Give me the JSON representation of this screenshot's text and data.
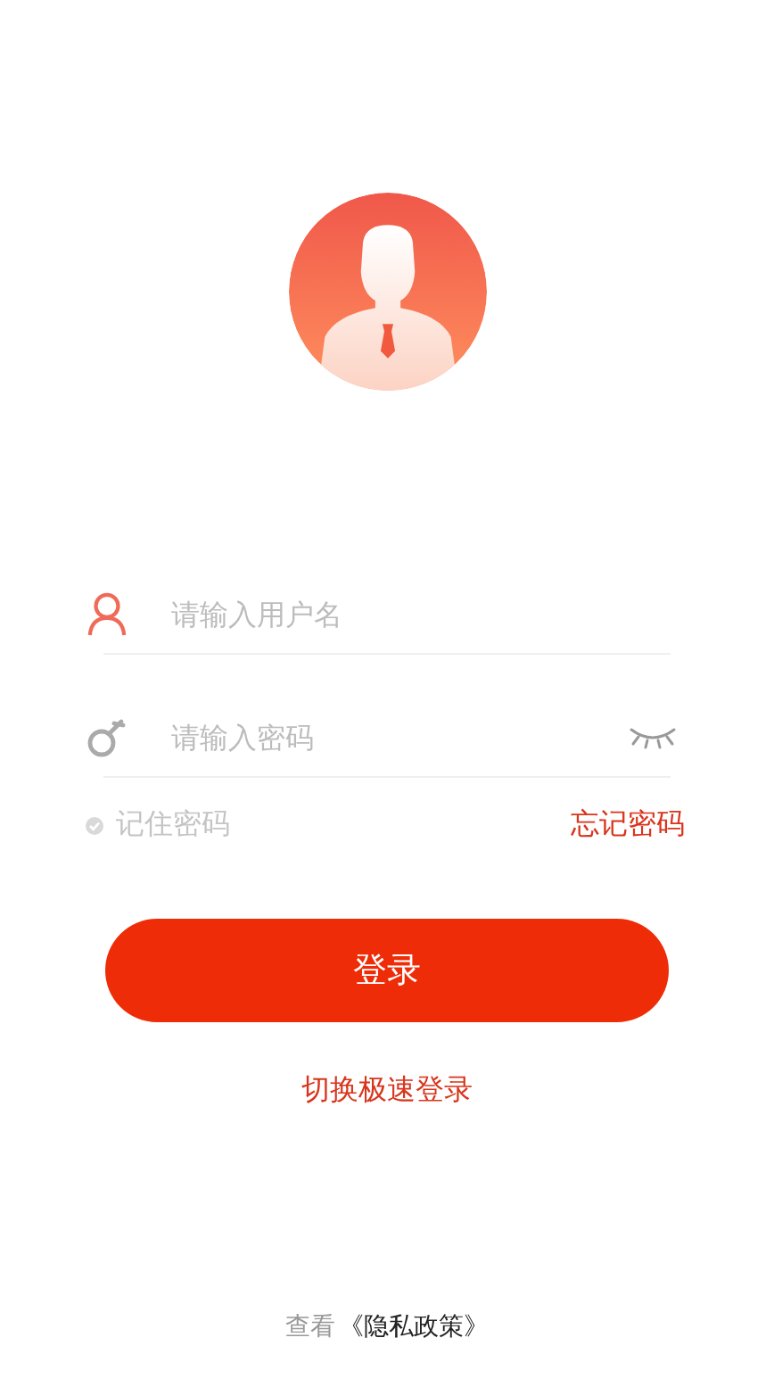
{
  "username": {
    "placeholder": "请输入用户名"
  },
  "password": {
    "placeholder": "请输入密码"
  },
  "remember": {
    "label": "记住密码",
    "checked": false
  },
  "forgot_link": "忘记密码",
  "login_button": "登录",
  "switch_link": "切换极速登录",
  "footer": {
    "prefix": "查看",
    "link": "《隐私政策》"
  }
}
